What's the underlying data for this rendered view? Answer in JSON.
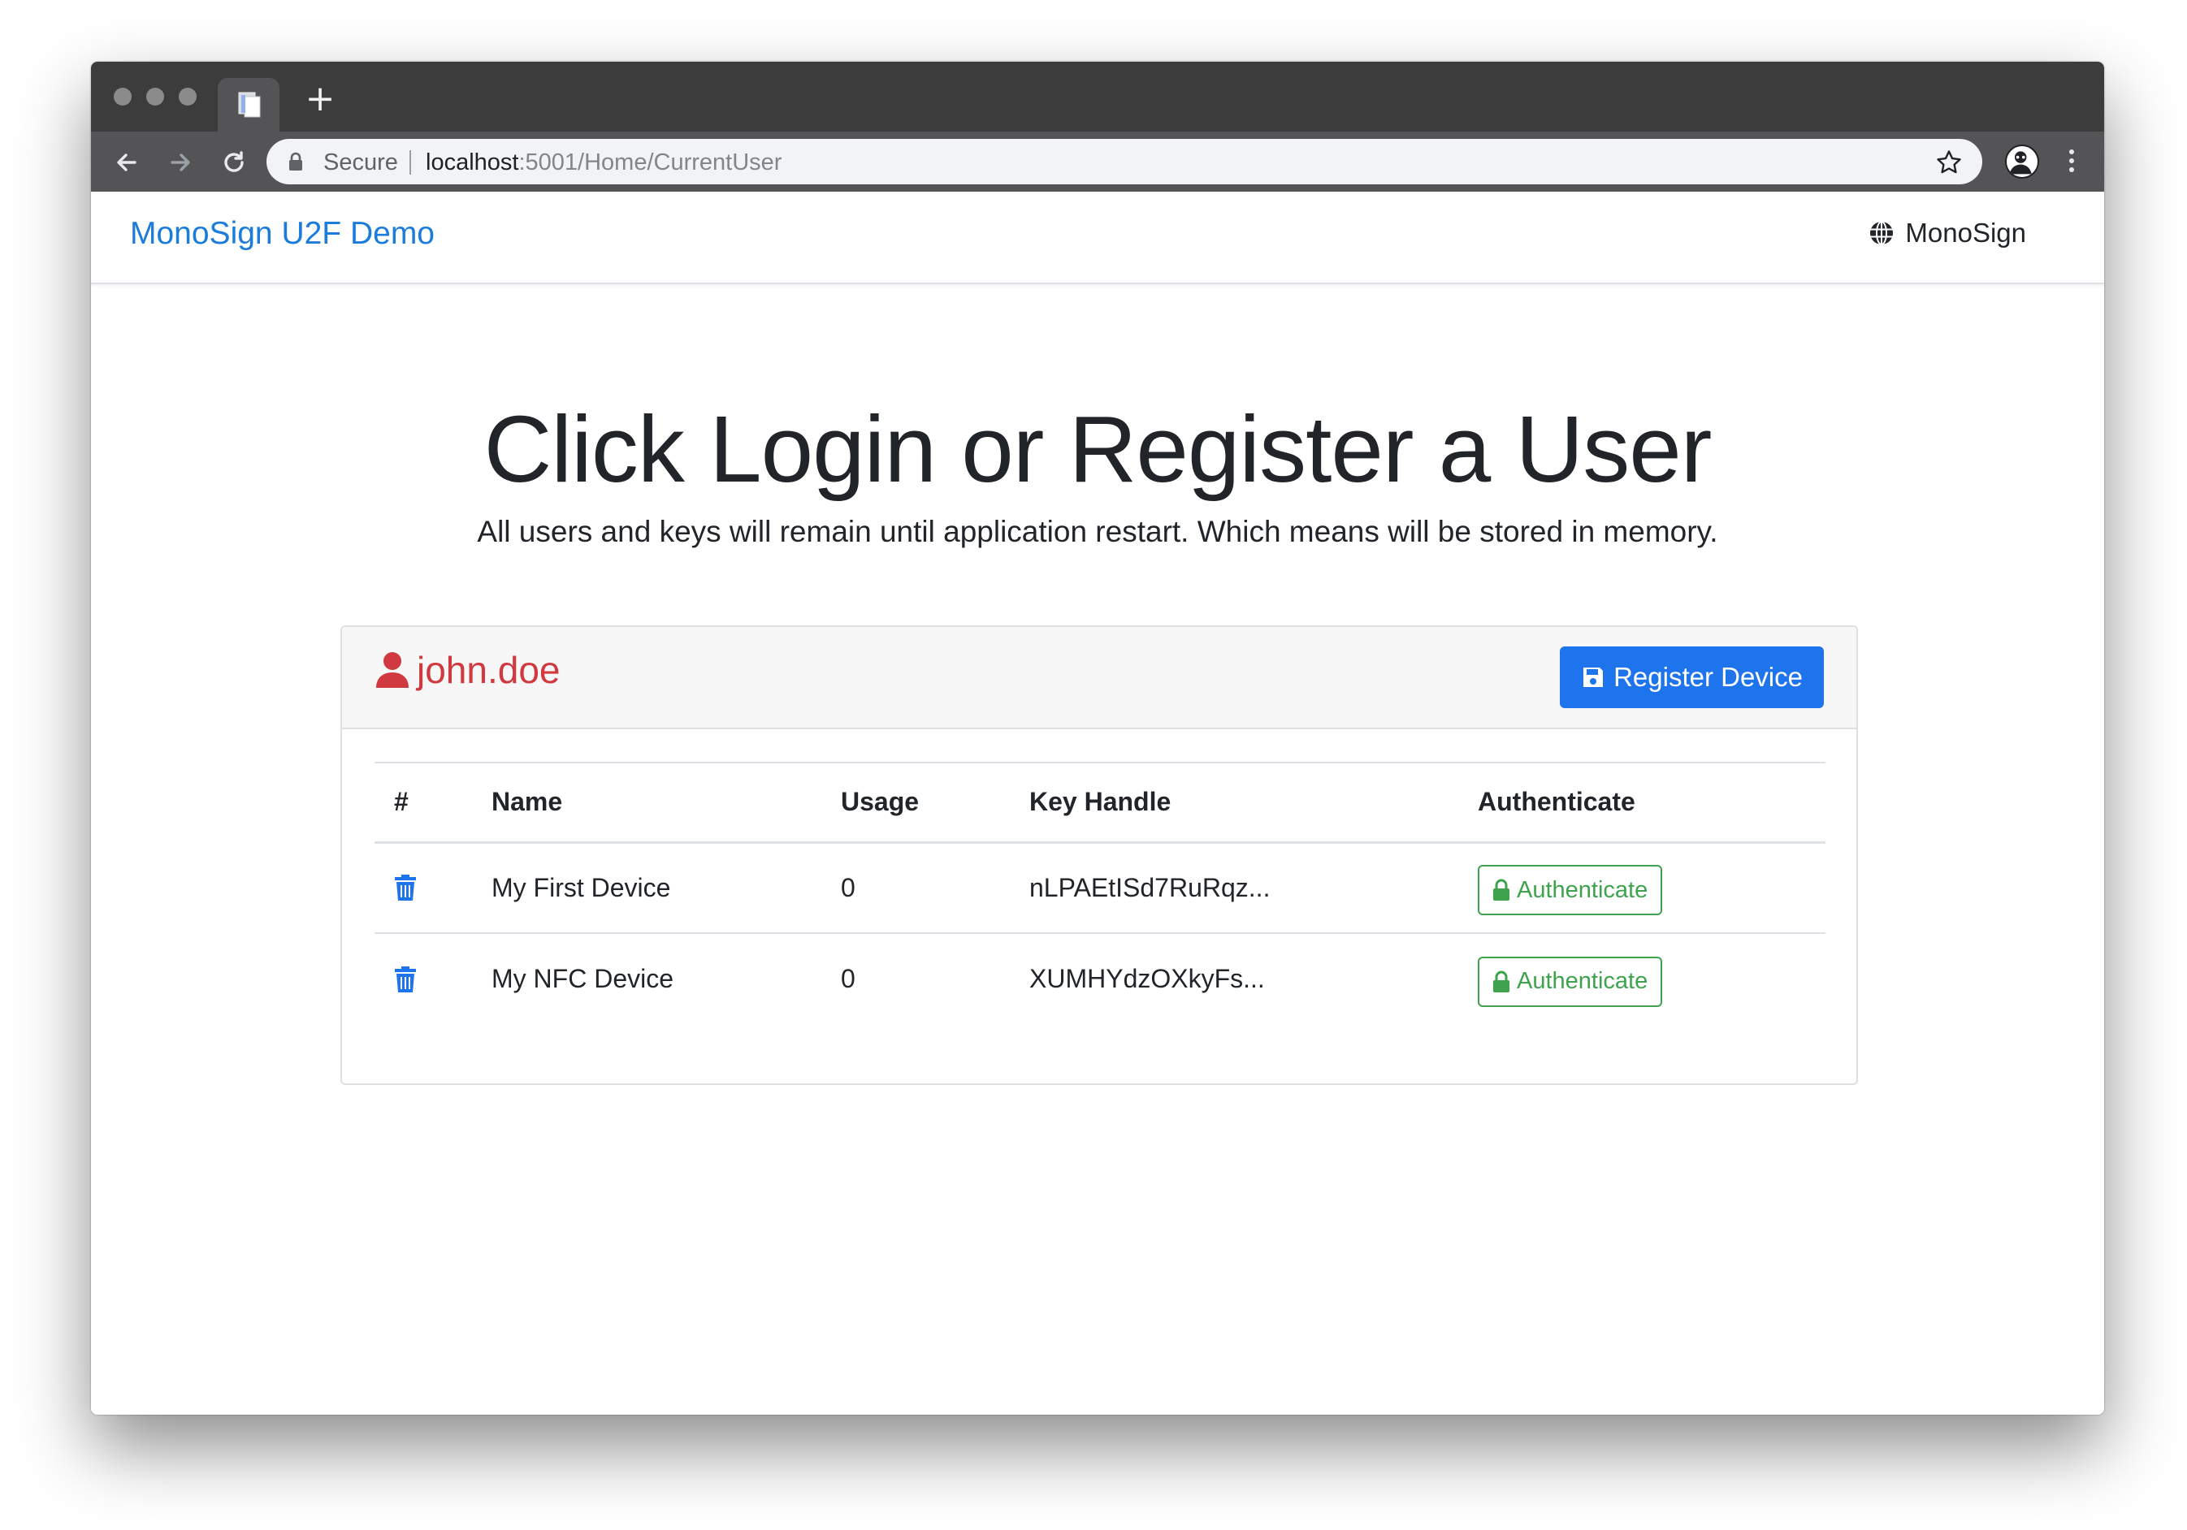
{
  "browser": {
    "tab_icon": "document-icon",
    "new_tab_label": "+",
    "secure_label": "Secure",
    "url_host": "localhost",
    "url_path": ":5001/Home/CurrentUser"
  },
  "navbar": {
    "brand": "MonoSign U2F Demo",
    "right_icon": "globe-icon",
    "right_label": "MonoSign"
  },
  "hero": {
    "title": "Click Login or Register a User",
    "lead": "All users and keys will remain until application restart. Which means will be stored in memory."
  },
  "card": {
    "username": "john.doe",
    "register_button": "Register Device",
    "columns": [
      "#",
      "Name",
      "Usage",
      "Key Handle",
      "Authenticate"
    ],
    "devices": [
      {
        "name": "My First Device",
        "usage": "0",
        "key_handle": "nLPAEtISd7RuRqz...",
        "action": "Authenticate"
      },
      {
        "name": "My NFC Device",
        "usage": "0",
        "key_handle": "XUMHYdzOXkyFs...",
        "action": "Authenticate"
      }
    ]
  },
  "colors": {
    "brand": "#1b7cdb",
    "username": "#d0393f",
    "primary_button": "#1e74ec",
    "success": "#3fa34d"
  }
}
